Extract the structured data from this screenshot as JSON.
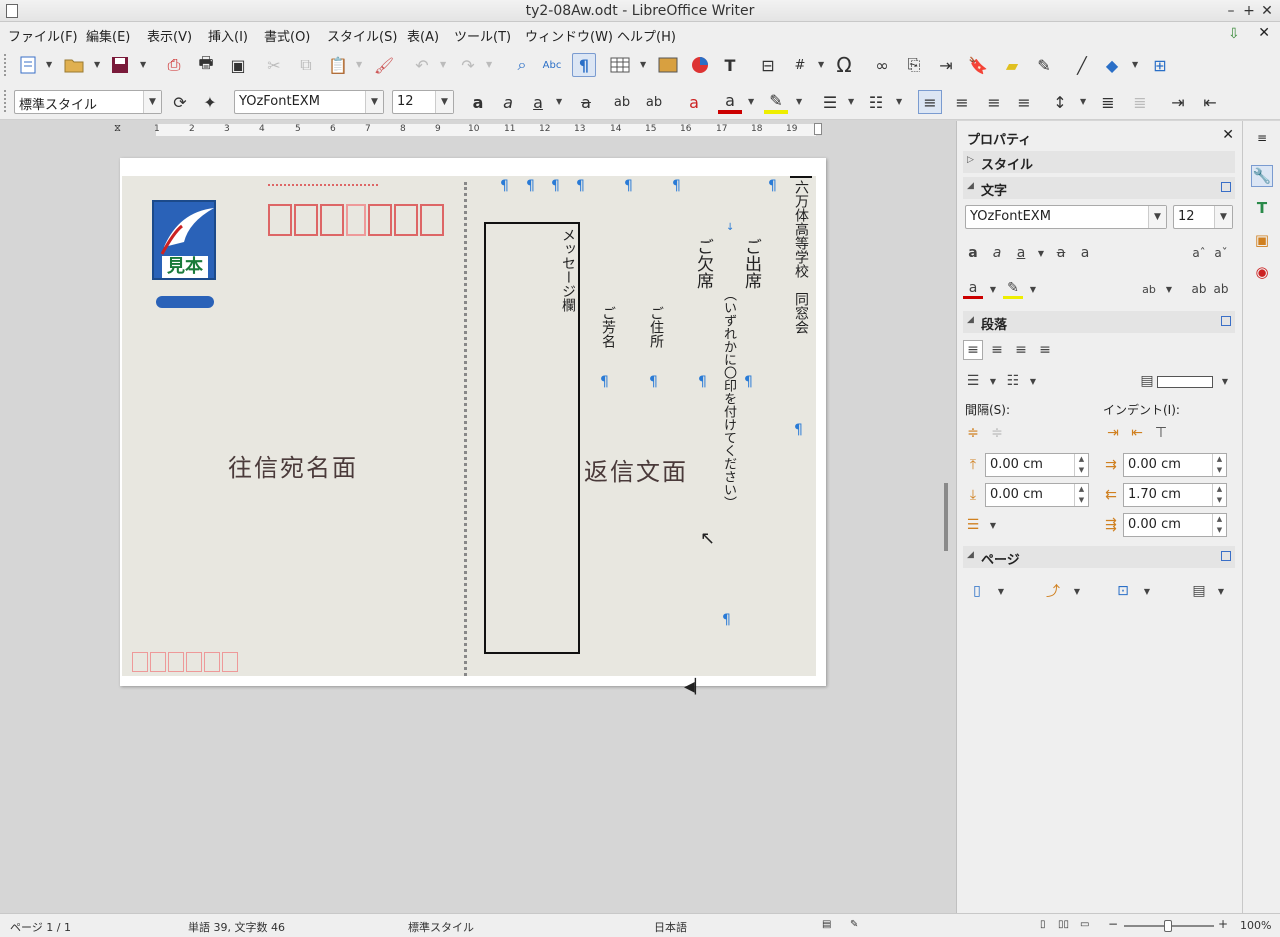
{
  "window": {
    "title": "ty2-08Aw.odt - LibreOffice Writer",
    "minimize": "–",
    "maximize": "+",
    "close": "✕"
  },
  "menu": {
    "file": "ファイル(F)",
    "edit": "編集(E)",
    "view": "表示(V)",
    "insert": "挿入(I)",
    "format": "書式(O)",
    "styles": "スタイル(S)",
    "table": "表(A)",
    "tools": "ツール(T)",
    "window": "ウィンドウ(W)",
    "help": "ヘルプ(H)"
  },
  "formatting": {
    "paragraph_style": "標準スタイル",
    "font_name": "YOzFontEXM",
    "font_size": "12"
  },
  "ruler": {
    "ticks": [
      "1",
      "2",
      "3",
      "4",
      "5",
      "6",
      "7",
      "8",
      "9",
      "10",
      "11",
      "12",
      "13",
      "14",
      "15",
      "16",
      "17",
      "18",
      "19"
    ]
  },
  "document": {
    "outbound_face": "往信宛名面",
    "reply_face": "返信文面",
    "message_column": "メッセージ欄",
    "school_name": "六万体高等学校　同窓会",
    "attend": "ご出席",
    "absent": "ご欠席",
    "instruction": "（いずれかに〇印を付けてください）",
    "address": "ご住所",
    "name": "ご芳名",
    "stamp_text": "見本",
    "pilcrow": "¶"
  },
  "sidebar": {
    "title": "プロパティ",
    "close": "✕",
    "sections": {
      "style": "スタイル",
      "character": "文字",
      "paragraph": "段落",
      "page": "ページ"
    },
    "font_name": "YOzFontEXM",
    "font_size": "12",
    "spacing_label": "間隔(S):",
    "indent_label": "インデント(I):",
    "above_spacing": "0.00 cm",
    "below_spacing": "0.00 cm",
    "before_indent": "0.00 cm",
    "after_indent": "1.70 cm",
    "first_line_indent": "0.00 cm"
  },
  "status": {
    "page": "ページ 1 / 1",
    "words": "単語 39, 文字数 46",
    "style": "標準スタイル",
    "language": "日本語",
    "zoom": "100%",
    "zoom_minus": "−",
    "zoom_plus": "+"
  },
  "colors": {
    "pilcrow": "#2a7bd6",
    "card_bg": "#e8e7e0",
    "accent": "#3a6fc7"
  }
}
